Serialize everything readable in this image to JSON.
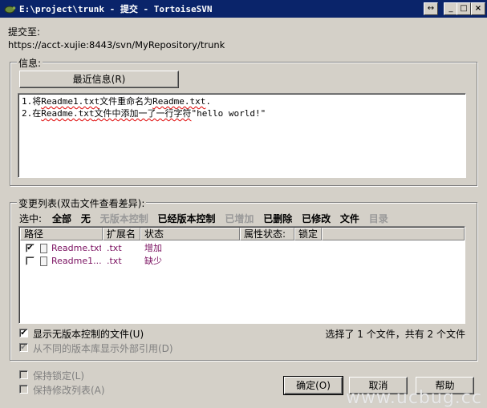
{
  "window": {
    "title": "E:\\project\\trunk - 提交 - TortoiseSVN",
    "btn_resize": "↔",
    "btn_minimize": "_",
    "btn_maximize": "□",
    "btn_close": "×"
  },
  "commit_to": {
    "label": "提交至:",
    "url": "https://acct-xujie:8443/svn/MyRepository/trunk"
  },
  "message": {
    "group_title": "信息:",
    "recent_button": "最近信息(R)",
    "line1_a": "1.将",
    "line1_b": "Readme1.txt",
    "line1_c": "文件重命名为",
    "line1_d": "Readme.txt",
    "line1_e": ".",
    "line2_a": "2.在",
    "line2_b": "Readme.txt",
    "line2_c": "文件中添加一了一行字符",
    "line2_d": "\"hello world!\""
  },
  "changes": {
    "group_title": "变更列表(双击文件查看差异):",
    "select_label": "选中:",
    "filters": [
      {
        "label": "全部",
        "enabled": true
      },
      {
        "label": "无",
        "enabled": true
      },
      {
        "label": "无版本控制",
        "enabled": false
      },
      {
        "label": "已经版本控制",
        "enabled": true
      },
      {
        "label": "已增加",
        "enabled": false
      },
      {
        "label": "已删除",
        "enabled": true
      },
      {
        "label": "已修改",
        "enabled": true
      },
      {
        "label": "文件",
        "enabled": true
      },
      {
        "label": "目录",
        "enabled": false
      }
    ],
    "columns": [
      "路径",
      "扩展名",
      "状态",
      "属性状态:",
      "锁定"
    ],
    "rows": [
      {
        "checked": true,
        "path": "Readme.txt",
        "ext": ".txt",
        "status": "增加"
      },
      {
        "checked": false,
        "path": "Readme1...",
        "ext": ".txt",
        "status": "缺少"
      }
    ],
    "show_unversioned": "显示无版本控制的文件(U)",
    "show_externals": "从不同的版本库显示外部引用(D)",
    "summary": "选择了 1 个文件，共有 2 个文件"
  },
  "bottom": {
    "keep_locks": "保持锁定(L)",
    "keep_changelist": "保持修改列表(A)",
    "ok": "确定(O)",
    "cancel": "取消",
    "help": "帮助"
  },
  "watermark": "www.ucbug.cc"
}
